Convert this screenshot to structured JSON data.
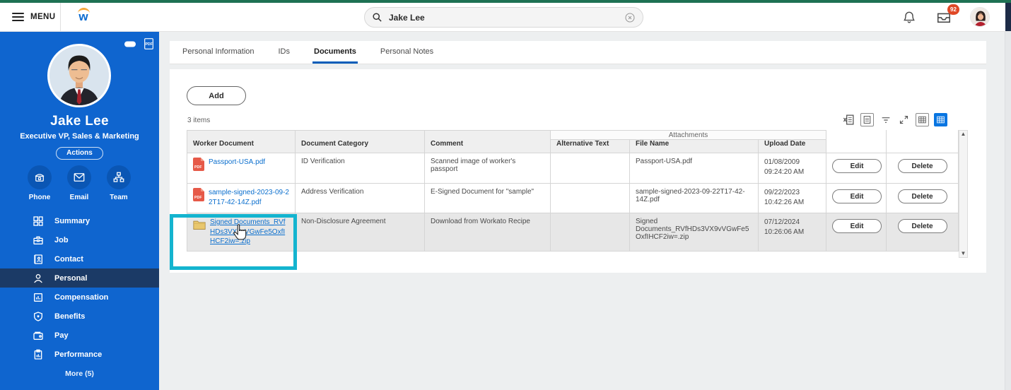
{
  "topbar": {
    "menu_label": "MENU",
    "brand_letter": "w",
    "search": {
      "value": "Jake Lee"
    },
    "inbox_badge": "92"
  },
  "profile": {
    "name": "Jake Lee",
    "title": "Executive VP, Sales & Marketing",
    "actions_label": "Actions",
    "quick_actions": [
      {
        "label": "Phone"
      },
      {
        "label": "Email"
      },
      {
        "label": "Team"
      }
    ]
  },
  "nav": {
    "items": [
      {
        "label": "Summary"
      },
      {
        "label": "Job"
      },
      {
        "label": "Contact"
      },
      {
        "label": "Personal"
      },
      {
        "label": "Compensation"
      },
      {
        "label": "Benefits"
      },
      {
        "label": "Pay"
      },
      {
        "label": "Performance"
      }
    ],
    "more_label": "More (5)"
  },
  "tabs": [
    {
      "label": "Personal Information"
    },
    {
      "label": "IDs"
    },
    {
      "label": "Documents"
    },
    {
      "label": "Personal Notes"
    }
  ],
  "content": {
    "add_label": "Add",
    "items_count": "3 items",
    "table": {
      "group_header": "Attachments",
      "columns": {
        "worker_document": "Worker Document",
        "document_category": "Document Category",
        "comment": "Comment",
        "alternative_text": "Alternative Text",
        "file_name": "File Name",
        "upload_date": "Upload Date"
      },
      "rows": [
        {
          "document": "Passport-USA.pdf",
          "category": "ID Verification",
          "comment": "Scanned image of worker's passport",
          "alternative_text": "",
          "file_name": "Passport-USA.pdf",
          "upload_date": "01/08/2009",
          "upload_time": "09:24:20 AM",
          "edit_label": "Edit",
          "delete_label": "Delete"
        },
        {
          "document": "sample-signed-2023-09-22T17-42-14Z.pdf",
          "category": "Address Verification",
          "comment": "E-Signed Document for \"sample\"",
          "alternative_text": "",
          "file_name": "sample-signed-2023-09-22T17-42-14Z.pdf",
          "upload_date": "09/22/2023",
          "upload_time": "10:42:26 AM",
          "edit_label": "Edit",
          "delete_label": "Delete"
        },
        {
          "document": "Signed Documents_RVfHDs3VX9vVGwFe5OxfIHCF2iw=.zip",
          "category": "Non-Disclosure Agreement",
          "comment": "Download from Workato Recipe",
          "alternative_text": "",
          "file_name": "Signed Documents_RVfHDs3VX9vVGwFe5OxfIHCF2iw=.zip",
          "upload_date": "07/12/2024",
          "upload_time": "10:26:06 AM",
          "edit_label": "Edit",
          "delete_label": "Delete"
        }
      ]
    }
  },
  "icons": {
    "pdf_label": "PDF"
  },
  "colors": {
    "top_strip_green": "#1e7153",
    "sidebar_blue": "#0f65cf",
    "nav_active_navy": "#1b3a66",
    "highlight_teal": "#14b4cf",
    "link_blue": "#0b6fce",
    "badge_red": "#e04826",
    "active_tab_underline": "#005cb9",
    "grid_selected_blue": "#0875e1"
  }
}
